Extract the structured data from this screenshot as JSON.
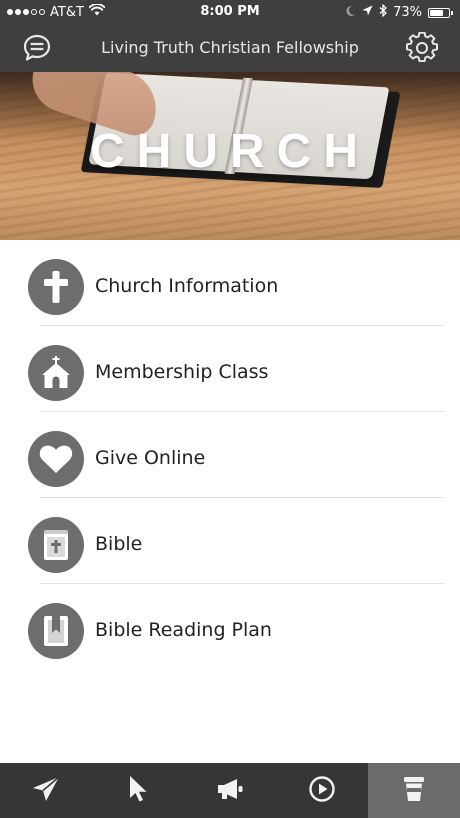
{
  "status_bar": {
    "carrier": "AT&T",
    "time": "8:00 PM",
    "battery": "73%",
    "battery_level": 0.73,
    "signal_bars_filled": 3,
    "signal_bars_total": 5,
    "icons": [
      "wifi-icon",
      "moon-icon",
      "location-arrow-icon",
      "bluetooth-icon",
      "battery-icon"
    ]
  },
  "nav": {
    "title": "Living Truth Christian Fellowship",
    "left_icon": "chat-bubble-icon",
    "right_icon": "gear-icon"
  },
  "hero": {
    "title": "CHURCH"
  },
  "menu": {
    "items": [
      {
        "label": "Church Information",
        "icon": "cross-icon"
      },
      {
        "label": "Membership Class",
        "icon": "church-building-icon"
      },
      {
        "label": "Give Online",
        "icon": "heart-icon"
      },
      {
        "label": "Bible",
        "icon": "bible-icon"
      },
      {
        "label": "Bible Reading Plan",
        "icon": "bookmark-book-icon"
      }
    ]
  },
  "tab_bar": {
    "tabs": [
      {
        "icon": "paper-plane-icon",
        "active": false
      },
      {
        "icon": "cursor-arrow-icon",
        "active": false
      },
      {
        "icon": "megaphone-icon",
        "active": false
      },
      {
        "icon": "play-circle-icon",
        "active": false
      },
      {
        "icon": "cup-icon",
        "active": true
      }
    ]
  },
  "colors": {
    "header_bg": "#3f3f3f",
    "icon_circle": "#6d6d6d",
    "tab_bar_bg": "#363636",
    "tab_active_bg": "#6b6b6b"
  }
}
